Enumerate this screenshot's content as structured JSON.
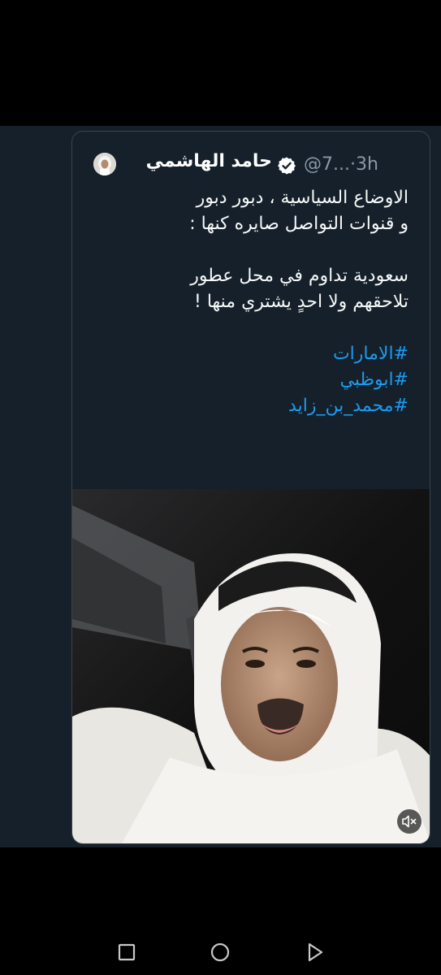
{
  "tweet": {
    "author_name": "حامد الهاشمي",
    "handle_time": "@7...·3h",
    "body_lines": [
      "الاوضاع السياسية ، دبور دبور",
      "و قنوات التواصل صايره كنها :",
      "",
      "سعودية تداوم في محل عطور",
      "تلاحقهم ولا احدٍ يشتري منها !"
    ],
    "hashtags": [
      "#الامارات",
      "#ابوظبي",
      "#محمد_بن_زايد"
    ]
  },
  "icons": {
    "verified": "verified-badge-icon",
    "mute": "speaker-muted-icon",
    "nav_recents": "square-icon",
    "nav_home": "circle-icon",
    "nav_back": "triangle-icon"
  },
  "colors": {
    "background": "#15202b",
    "border": "#38444d",
    "text": "#f7f9f9",
    "secondary_text": "#8b98a5",
    "link": "#1d9bf0"
  }
}
